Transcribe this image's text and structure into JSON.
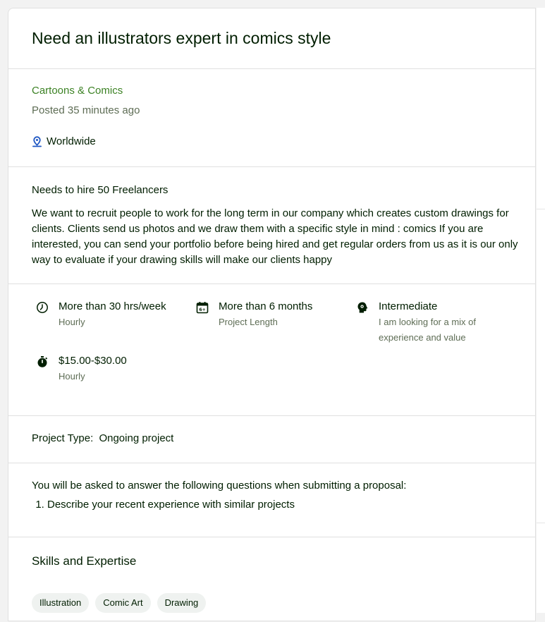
{
  "job": {
    "title": "Need an illustrators expert in comics style",
    "category": "Cartoons & Comics",
    "posted": "Posted 35 minutes ago",
    "location": "Worldwide"
  },
  "description": {
    "hire": "Needs to hire 50 Freelancers",
    "text": "We want to recruit people to work for the long term in our company which creates custom drawings for clients. Clients send us photos and we draw them with a specific style in mind : comics If you are interested, you can send your portfolio before being hired and get regular orders from us as it is our only way to evaluate if your drawing skills will make our clients happy"
  },
  "features": [
    {
      "icon": "clock-icon",
      "main": "More than 30 hrs/week",
      "sub": "Hourly"
    },
    {
      "icon": "calendar-icon",
      "main": "More than 6 months",
      "sub": "Project Length"
    },
    {
      "icon": "head-gear-icon",
      "main": "Intermediate",
      "sub": "I am looking for a mix of experience and value"
    },
    {
      "icon": "stopwatch-icon",
      "main": "$15.00-$30.00",
      "sub": "Hourly"
    }
  ],
  "project_type": {
    "label": "Project Type:",
    "value": "Ongoing project"
  },
  "questions": {
    "heading": "You will be asked to answer the following questions when submitting a proposal:",
    "items": [
      "Describe your recent experience with similar projects"
    ]
  },
  "skills": {
    "title": "Skills and Expertise",
    "chips": [
      "Illustration",
      "Comic Art",
      "Drawing"
    ]
  },
  "colors": {
    "accent_green": "#3c8224",
    "muted": "#5e6d55",
    "location_icon": "#1f57c3"
  }
}
